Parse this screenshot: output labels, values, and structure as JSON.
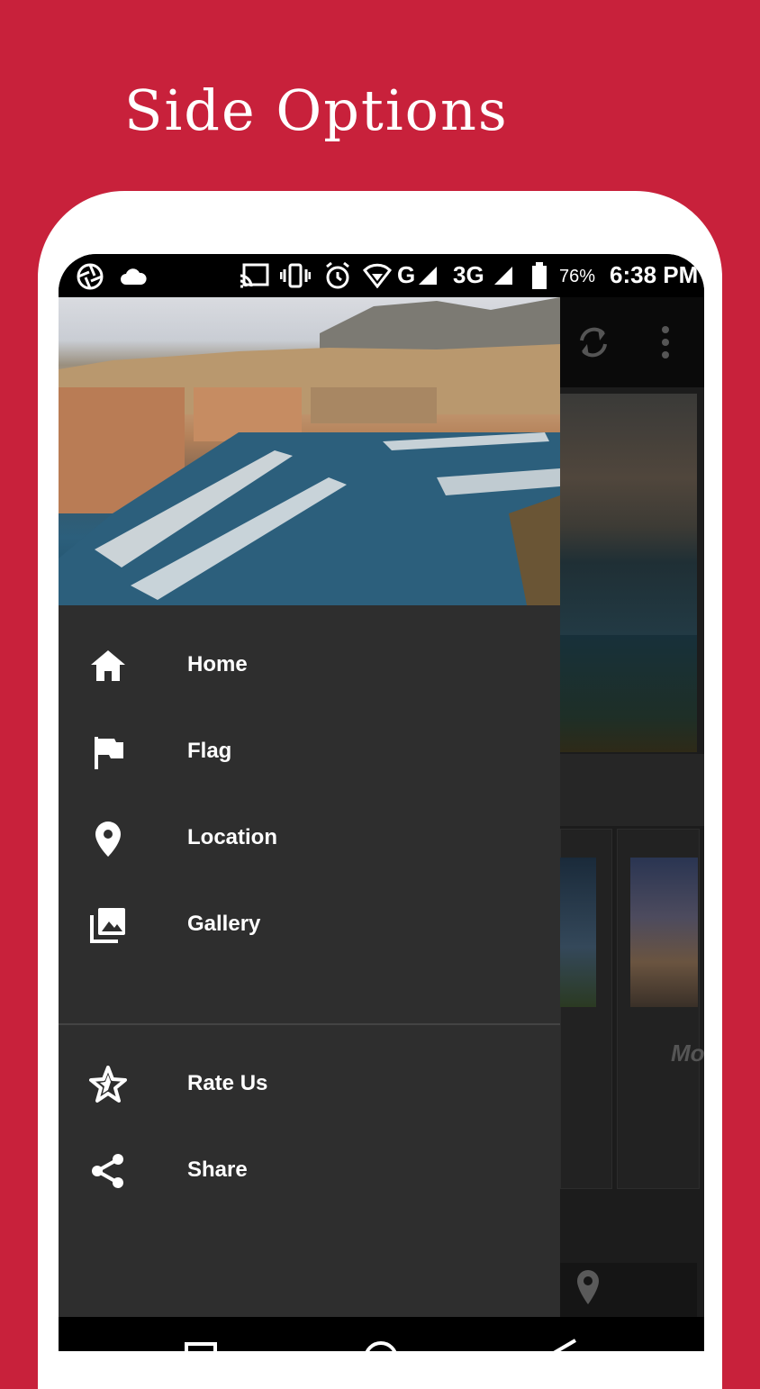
{
  "promo": {
    "title": "Side Options"
  },
  "status_bar": {
    "network_1": "G",
    "network_2": "3G",
    "battery": "76%",
    "time": "6:38 PM"
  },
  "drawer": {
    "items": [
      {
        "label": "Home",
        "icon": "home-icon"
      },
      {
        "label": "Flag",
        "icon": "flag-icon"
      },
      {
        "label": "Location",
        "icon": "location-pin-icon"
      },
      {
        "label": "Gallery",
        "icon": "gallery-icon"
      },
      {
        "label": "Rate Us",
        "icon": "star-icon"
      },
      {
        "label": "Share",
        "icon": "share-icon"
      }
    ]
  },
  "background_app": {
    "card_text": "Mo"
  },
  "colors": {
    "brand": "#c8213b",
    "drawer": "#2e2e2e",
    "status_bar": "#000000"
  }
}
